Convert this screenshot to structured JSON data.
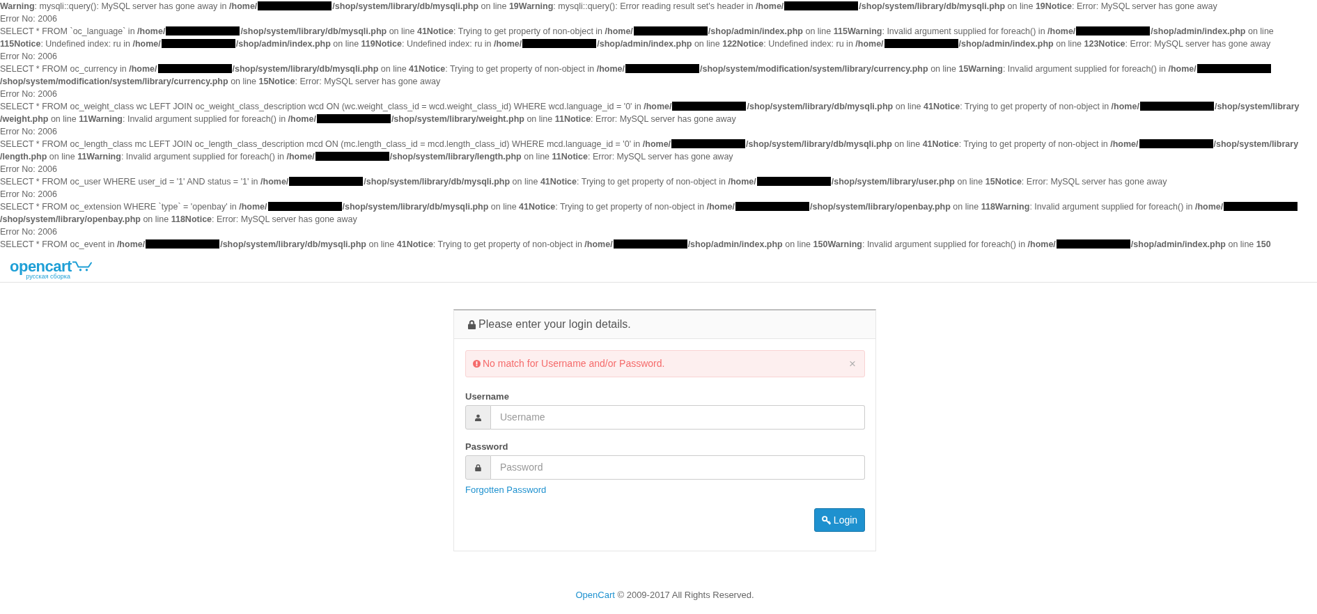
{
  "error_output": {
    "lines": [
      [
        {
          "kind": "text",
          "text": "**Warning**: mysqli::query(): MySQL server has gone away in **/home/**"
        },
        {
          "kind": "redacted"
        },
        {
          "kind": "text",
          "text": "**/shop/system/library/db/mysqli.php** on line **19Warning**: mysqli::query(): Error reading result set's header in **/home/**"
        },
        {
          "kind": "redacted"
        },
        {
          "kind": "text",
          "text": "**/shop/system/library/db/mysqli.php** on line **19Notice**: Error: MySQL server has gone away"
        }
      ],
      [
        {
          "kind": "text",
          "text": "Error No: 2006"
        }
      ],
      [
        {
          "kind": "text",
          "text": "SELECT * FROM `oc_language` in **/home/**"
        },
        {
          "kind": "redacted"
        },
        {
          "kind": "text",
          "text": "**/shop/system/library/db/mysqli.php** on line **41Notice**: Trying to get property of non-object in **/home/**"
        },
        {
          "kind": "redacted"
        },
        {
          "kind": "text",
          "text": "**/shop/admin/index.php** on line **115Warning**: Invalid argument supplied for foreach() in **/home/**"
        },
        {
          "kind": "redacted"
        },
        {
          "kind": "text",
          "text": "**/shop/admin/index.php** on line"
        }
      ],
      [
        {
          "kind": "text",
          "text": "**115Notice**: Undefined index: ru in **/home/**"
        },
        {
          "kind": "redacted"
        },
        {
          "kind": "text",
          "text": "**/shop/admin/index.php** on line **119Notice**: Undefined index: ru in **/home/**"
        },
        {
          "kind": "redacted"
        },
        {
          "kind": "text",
          "text": "**/shop/admin/index.php** on line **122Notice**: Undefined index: ru in **/home/**"
        },
        {
          "kind": "redacted"
        },
        {
          "kind": "text",
          "text": "**/shop/admin/index.php** on line **123Notice**: Error: MySQL server has gone away"
        }
      ],
      [
        {
          "kind": "text",
          "text": "Error No: 2006"
        }
      ],
      [
        {
          "kind": "text",
          "text": "SELECT * FROM oc_currency in **/home/**"
        },
        {
          "kind": "redacted"
        },
        {
          "kind": "text",
          "text": "**/shop/system/library/db/mysqli.php** on line **41Notice**: Trying to get property of non-object in **/home/**"
        },
        {
          "kind": "redacted"
        },
        {
          "kind": "text",
          "text": "**/shop/system/modification/system/library/currency.php** on line **15Warning**: Invalid argument supplied for foreach() in **/home/**"
        },
        {
          "kind": "redacted"
        }
      ],
      [
        {
          "kind": "text",
          "text": "**/shop/system/modification/system/library/currency.php** on line **15Notice**: Error: MySQL server has gone away"
        }
      ],
      [
        {
          "kind": "text",
          "text": "Error No: 2006"
        }
      ],
      [
        {
          "kind": "text",
          "text": "SELECT * FROM oc_weight_class wc LEFT JOIN oc_weight_class_description wcd ON (wc.weight_class_id = wcd.weight_class_id) WHERE wcd.language_id = '0' in **/home/**"
        },
        {
          "kind": "redacted"
        },
        {
          "kind": "text",
          "text": "**/shop/system/library/db/mysqli.php** on line **41Notice**: Trying to get property of non-object in **/home/**"
        },
        {
          "kind": "redacted"
        },
        {
          "kind": "text",
          "text": "**/shop/system/library**"
        }
      ],
      [
        {
          "kind": "text",
          "text": "**/weight.php** on line **11Warning**: Invalid argument supplied for foreach() in **/home/**"
        },
        {
          "kind": "redacted"
        },
        {
          "kind": "text",
          "text": "**/shop/system/library/weight.php** on line **11Notice**: Error: MySQL server has gone away"
        }
      ],
      [
        {
          "kind": "text",
          "text": "Error No: 2006"
        }
      ],
      [
        {
          "kind": "text",
          "text": "SELECT * FROM oc_length_class mc LEFT JOIN oc_length_class_description mcd ON (mc.length_class_id = mcd.length_class_id) WHERE mcd.language_id = '0' in **/home/**"
        },
        {
          "kind": "redacted"
        },
        {
          "kind": "text",
          "text": "**/shop/system/library/db/mysqli.php** on line **41Notice**: Trying to get property of non-object in **/home/**"
        },
        {
          "kind": "redacted"
        },
        {
          "kind": "text",
          "text": "**/shop/system/library**"
        }
      ],
      [
        {
          "kind": "text",
          "text": "**/length.php** on line **11Warning**: Invalid argument supplied for foreach() in **/home/**"
        },
        {
          "kind": "redacted"
        },
        {
          "kind": "text",
          "text": "**/shop/system/library/length.php** on line **11Notice**: Error: MySQL server has gone away"
        }
      ],
      [
        {
          "kind": "text",
          "text": "Error No: 2006"
        }
      ],
      [
        {
          "kind": "text",
          "text": "SELECT * FROM oc_user WHERE user_id = '1' AND status = '1' in **/home/**"
        },
        {
          "kind": "redacted"
        },
        {
          "kind": "text",
          "text": "**/shop/system/library/db/mysqli.php** on line **41Notice**: Trying to get property of non-object in **/home/**"
        },
        {
          "kind": "redacted"
        },
        {
          "kind": "text",
          "text": "**/shop/system/library/user.php** on line **15Notice**: Error: MySQL server has gone away"
        }
      ],
      [
        {
          "kind": "text",
          "text": "Error No: 2006"
        }
      ],
      [
        {
          "kind": "text",
          "text": "SELECT * FROM oc_extension WHERE `type` = 'openbay' in **/home/**"
        },
        {
          "kind": "redacted"
        },
        {
          "kind": "text",
          "text": "**/shop/system/library/db/mysqli.php** on line **41Notice**: Trying to get property of non-object in **/home/**"
        },
        {
          "kind": "redacted"
        },
        {
          "kind": "text",
          "text": "**/shop/system/library/openbay.php** on line **118Warning**: Invalid argument supplied for foreach() in **/home/**"
        },
        {
          "kind": "redacted"
        }
      ],
      [
        {
          "kind": "text",
          "text": "**/shop/system/library/openbay.php** on line **118Notice**: Error: MySQL server has gone away"
        }
      ],
      [
        {
          "kind": "text",
          "text": "Error No: 2006"
        }
      ],
      [
        {
          "kind": "text",
          "text": "SELECT * FROM oc_event in **/home/**"
        },
        {
          "kind": "redacted"
        },
        {
          "kind": "text",
          "text": "**/shop/system/library/db/mysqli.php** on line **41Notice**: Trying to get property of non-object in **/home/**"
        },
        {
          "kind": "redacted"
        },
        {
          "kind": "text",
          "text": "**/shop/admin/index.php** on line **150Warning**: Invalid argument supplied for foreach() in **/home/**"
        },
        {
          "kind": "redacted"
        },
        {
          "kind": "text",
          "text": "**/shop/admin/index.php** on line **150**"
        }
      ]
    ]
  },
  "header": {
    "logo": {
      "wordmark": "opencart",
      "tagline": "русская сборка"
    }
  },
  "login_panel": {
    "title": "Please enter your login details.",
    "alert": {
      "message": "No match for Username and/or Password.",
      "close": "×"
    },
    "fields": [
      {
        "kind": "user",
        "label": "Username",
        "placeholder": "Username"
      },
      {
        "kind": "password",
        "label": "Password",
        "placeholder": "Password"
      }
    ],
    "forgot_link": "Forgotten Password",
    "submit": "Login"
  },
  "footer": {
    "link": "OpenCart",
    "text": "© 2009-2017 All Rights Reserved."
  }
}
